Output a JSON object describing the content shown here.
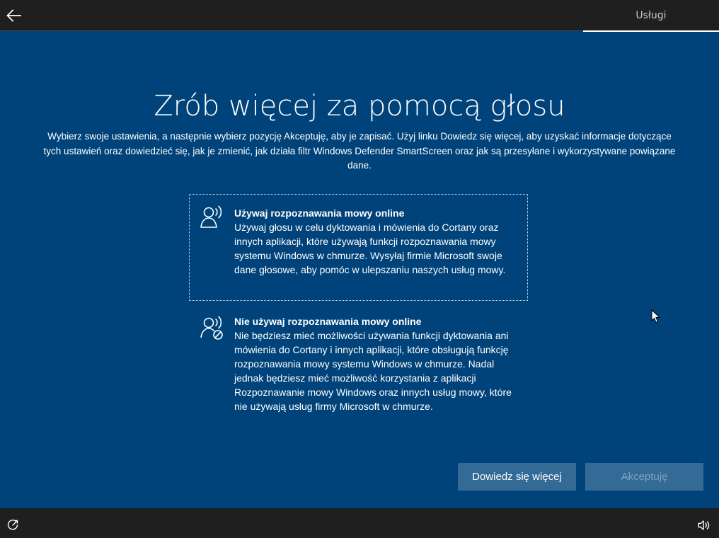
{
  "header": {
    "back_icon": "back-arrow-icon",
    "tabs": [
      {
        "label": "Usługi",
        "active": true
      }
    ]
  },
  "main": {
    "title": "Zrób więcej za pomocą głosu",
    "intro": "Wybierz swoje ustawienia, a następnie wybierz pozycję Akceptuję, aby je zapisać. Użyj linku Dowiedz się więcej, aby uzyskać informacje dotyczące tych ustawień oraz dowiedzieć się, jak je zmienić, jak działa filtr Windows Defender SmartScreen oraz jak są przesyłane i wykorzystywane powiązane dane.",
    "options": [
      {
        "title": "Używaj rozpoznawania mowy online",
        "description": "Używaj głosu w celu dyktowania i mówienia do Cortany oraz innych aplikacji, które używają funkcji rozpoznawania mowy systemu Windows w chmurze. Wysyłaj firmie Microsoft swoje dane głosowe, aby pomóc w ulepszaniu naszych usług mowy.",
        "icon": "speech-recognition-icon",
        "selected": true
      },
      {
        "title": "Nie używaj rozpoznawania mowy online",
        "description": "Nie będziesz mieć możliwości używania funkcji dyktowania ani mówienia do Cortany i innych aplikacji, które obsługują funkcję rozpoznawania mowy systemu Windows w chmurze. Nadal jednak będziesz mieć możliwość korzystania z aplikacji Rozpoznawanie mowy Windows oraz innych usług mowy, które nie używają usług firmy Microsoft w chmurze.",
        "icon": "speech-recognition-off-icon",
        "selected": false
      }
    ]
  },
  "buttons": {
    "learn_more": "Dowiedz się więcej",
    "accept": "Akceptuję"
  },
  "footer": {
    "ease_of_access_icon": "ease-of-access-icon",
    "volume_icon": "volume-icon"
  },
  "colors": {
    "background": "#00437a",
    "bars": "#1f1f1f",
    "button": "#336a96",
    "disabled_text": "#7ea3c2"
  }
}
